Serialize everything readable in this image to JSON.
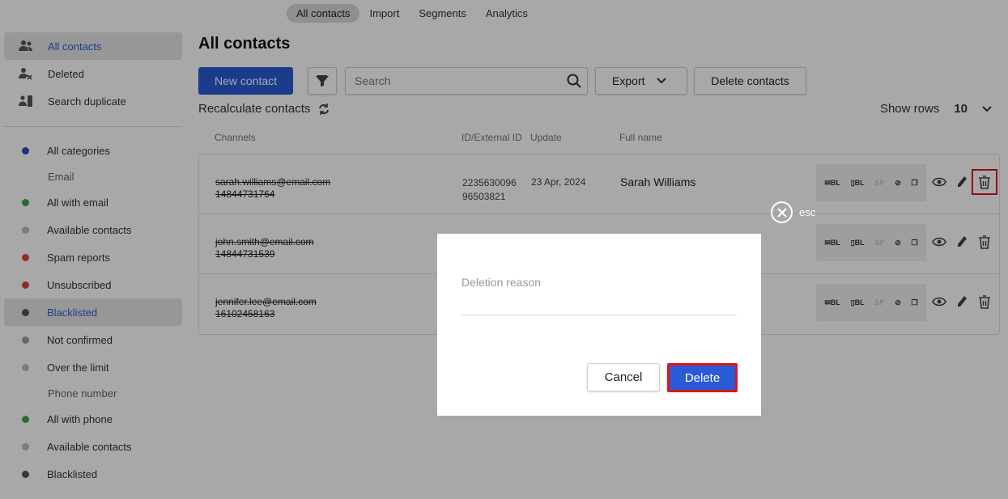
{
  "topnav": {
    "tabs": [
      "All contacts",
      "Import",
      "Segments",
      "Analytics"
    ],
    "active": "All contacts"
  },
  "sidebar": {
    "items": [
      {
        "label": "All contacts",
        "icon": "users-icon"
      },
      {
        "label": "Deleted",
        "icon": "user-x-icon"
      },
      {
        "label": "Search duplicate",
        "icon": "duplicate-icon"
      }
    ],
    "all_categories": "All categories",
    "email_group": "Email",
    "email_items": [
      {
        "label": "All with email",
        "color": "#3aa845"
      },
      {
        "label": "Available contacts",
        "color": "#bdbdbd"
      },
      {
        "label": "Spam reports",
        "color": "#d9443a"
      },
      {
        "label": "Unsubscribed",
        "color": "#d9443a"
      },
      {
        "label": "Blacklisted",
        "color": "#555555"
      },
      {
        "label": "Not confirmed",
        "color": "#9e9e9e"
      },
      {
        "label": "Over the limit",
        "color": "#bdbdbd"
      }
    ],
    "phone_group": "Phone number",
    "phone_items": [
      {
        "label": "All with phone",
        "color": "#3aa845"
      },
      {
        "label": "Available contacts",
        "color": "#bdbdbd"
      },
      {
        "label": "Blacklisted",
        "color": "#555555"
      }
    ]
  },
  "main": {
    "title": "All contacts",
    "new_contact": "New contact",
    "search_placeholder": "Search",
    "export": "Export",
    "delete_contacts": "Delete contacts",
    "recalculate": "Recalculate contacts",
    "show_rows_label": "Show rows",
    "show_rows_value": "10",
    "columns": [
      "Channels",
      "ID/External ID",
      "Update",
      "Full name"
    ],
    "rows": [
      {
        "email": "sarah.williams@email.com",
        "phone": "14844731764",
        "id": "2235630096",
        "ext_id": "96503821",
        "update": "23 Apr, 2024",
        "name": "Sarah Williams"
      },
      {
        "email": "john.smith@email.com",
        "phone": "14844731539",
        "id": "",
        "ext_id": "",
        "update": "",
        "name": ""
      },
      {
        "email": "jennifer.lee@email.com",
        "phone": "16102458163",
        "id": "",
        "ext_id": "",
        "update": "",
        "name": ""
      }
    ]
  },
  "modal": {
    "esc": "esc",
    "field_label": "Deletion reason",
    "cancel": "Cancel",
    "delete": "Delete"
  },
  "colors": {
    "accent": "#2a5bd7",
    "highlight": "#e01515"
  }
}
